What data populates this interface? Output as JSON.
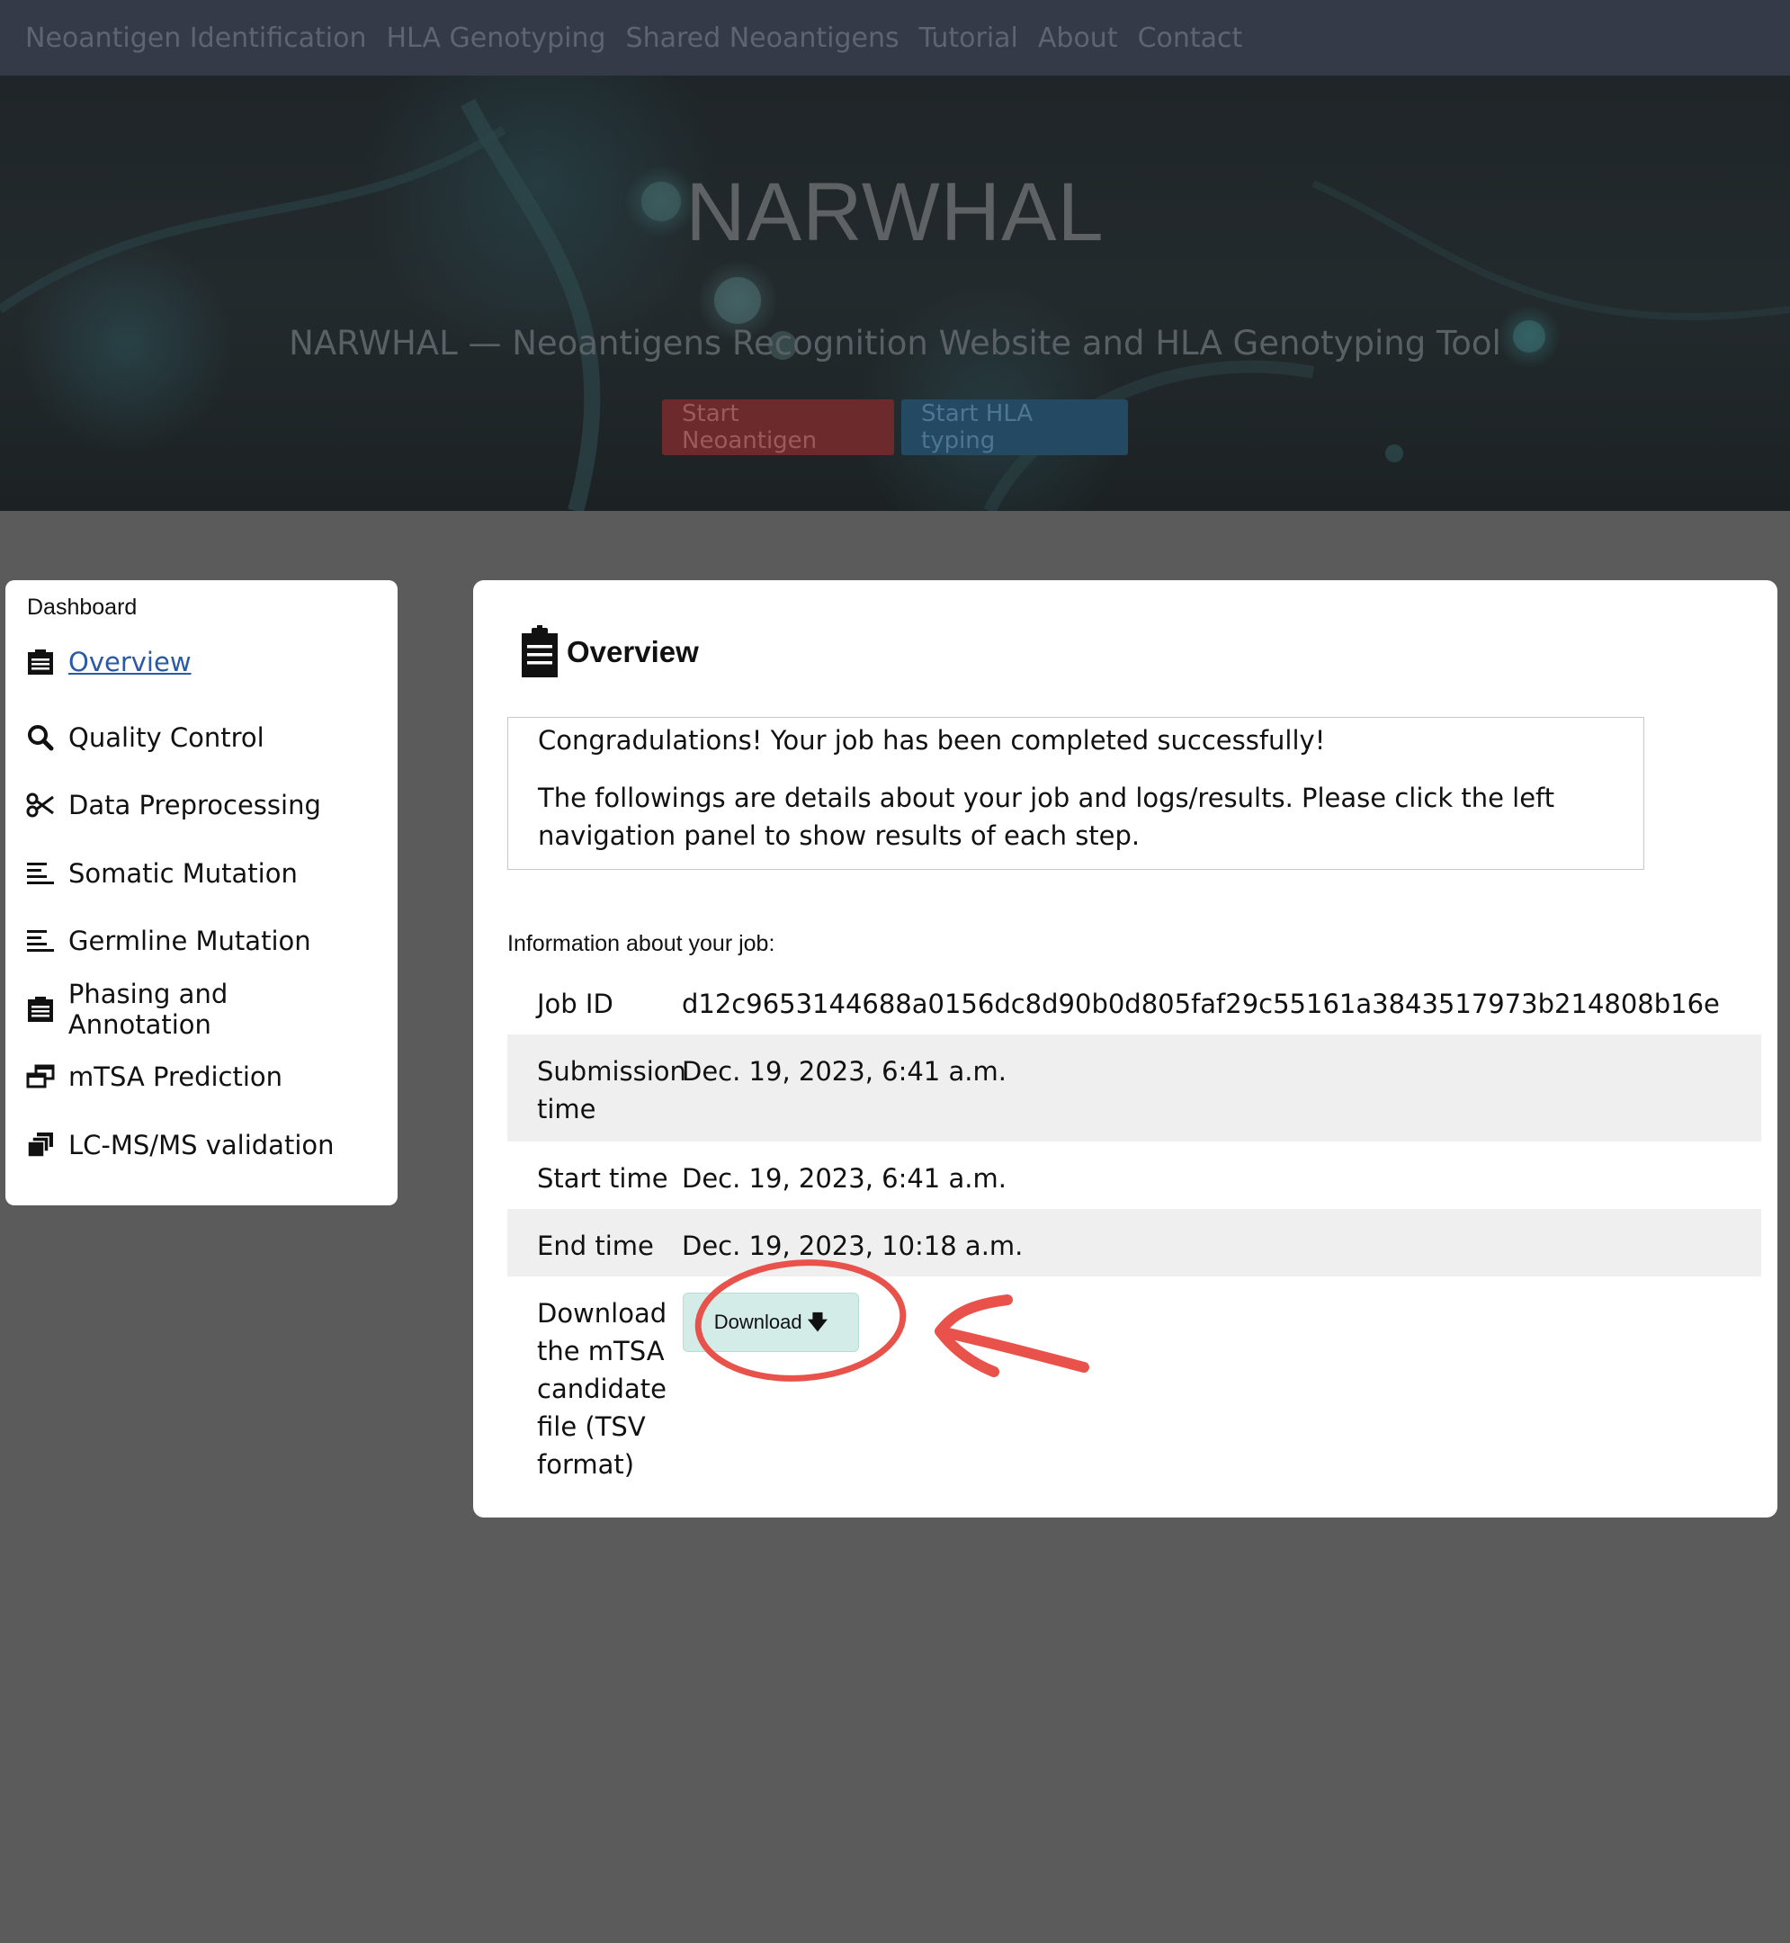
{
  "nav": {
    "items": [
      {
        "label": "Neoantigen Identification"
      },
      {
        "label": "HLA Genotyping"
      },
      {
        "label": "Shared Neoantigens"
      },
      {
        "label": "Tutorial"
      },
      {
        "label": "About"
      },
      {
        "label": "Contact"
      }
    ]
  },
  "hero": {
    "title": "NARWHAL",
    "subtitle": "NARWHAL — Neoantigens Recognition Website and HLA Genotyping Tool",
    "button_neoantigen": "Start Neoantigen",
    "button_hla": "Start HLA typing"
  },
  "sidebar": {
    "header": "Dashboard",
    "items": [
      {
        "label": " Overview",
        "icon": "clipboard-icon"
      },
      {
        "label": "Quality Control",
        "icon": "search-icon"
      },
      {
        "label": "Data Preprocessing",
        "icon": "scissors-icon"
      },
      {
        "label": "Somatic Mutation",
        "icon": "align-left-icon"
      },
      {
        "label": "Germline Mutation",
        "icon": "align-left-icon"
      },
      {
        "label": "Phasing and Annotation",
        "icon": "clipboard-icon"
      },
      {
        "label": "mTSA Prediction",
        "icon": "windows-icon"
      },
      {
        "label": "LC-MS/MS validation",
        "icon": "stack-icon"
      }
    ]
  },
  "main": {
    "title": "Overview",
    "notice": {
      "congrats": "Congradulations! Your job has been completed successfully!",
      "details": "The followings are details about your job and logs/results. Please click the left navigation panel to show results of each step."
    },
    "info_label": "Information about your job:",
    "rows": [
      {
        "key": "Job ID",
        "value": "d12c9653144688a0156dc8d90b0d805faf29c55161a3843517973b214808b16e"
      },
      {
        "key": "Submission time",
        "value": "Dec. 19, 2023, 6:41 a.m."
      },
      {
        "key": "Start time",
        "value": "Dec. 19, 2023, 6:41 a.m."
      },
      {
        "key": "End time",
        "value": "Dec. 19, 2023, 10:18 a.m."
      },
      {
        "key": "Download the mTSA candidate file (TSV format)",
        "value": ""
      }
    ],
    "download_label": "Download"
  },
  "colors": {
    "annotation": "#e8524b",
    "download_button": "#d3ece8",
    "active_link": "#2a5aa5"
  }
}
